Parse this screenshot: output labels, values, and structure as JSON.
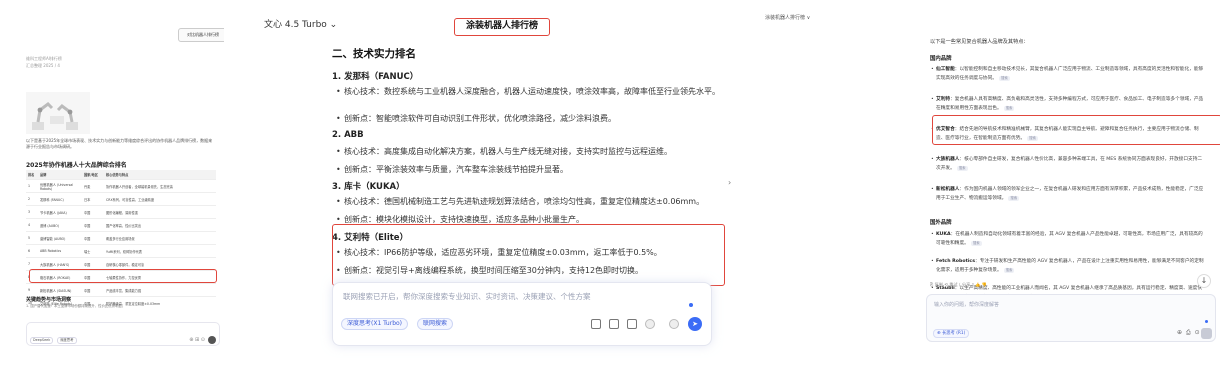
{
  "panel1": {
    "compare_button": "对比机器人排行榜",
    "meta_line1": "维科工程师AI排行榜",
    "meta_line2": "汇总整理 2025 / 4",
    "intro": "以下是基于2025年全球市场表现、技术实力与创新能力等维度综合评出的协作机器人品牌排行榜，数据来源于行业报告与市场调研。",
    "section_title": "2025年协作机器人十大品牌综合排名",
    "table_headers": [
      "排名",
      "品牌",
      "国家/地区",
      "核心优势与特点"
    ],
    "table_rows": [
      [
        "1",
        "优傲机器人 (Universal Robots)",
        "丹麦",
        "协作机器人开创者，全球装机量领先，生态完善"
      ],
      [
        "2",
        "发那科 (FANUC)",
        "日本",
        "CRX系列，可靠性高，工业级精度"
      ],
      [
        "3",
        "节卡机器人 (JAKA)",
        "中国",
        "图形化编程，易用性强"
      ],
      [
        "4",
        "邀博 (AUBO)",
        "中国",
        "国产化率高，性价比突出"
      ],
      [
        "5",
        "遨博智能 (AUBO)",
        "中国",
        "覆盖多行业应用场景"
      ],
      [
        "6",
        "ABB Robotics",
        "瑞士",
        "YuMi系列，双臂协作代表"
      ],
      [
        "7",
        "大族机器人 (HAN'S)",
        "中国",
        "自研核心零部件，稳定可靠"
      ],
      [
        "8",
        "珞石机器人 (ROKAE)",
        "中国",
        "七轴柔性协作，力控优秀"
      ],
      [
        "9",
        "新松机器人 (SIASUN)",
        "中国",
        "产品线丰富，集成能力强"
      ],
      [
        "10",
        "艾利特 (Elite Robots)",
        "中国",
        "防护等级高，重复定位精度±0.03mm"
      ]
    ],
    "subsection_title": "关键趋势与市场洞察",
    "subsection_text": "1. 国产替代加速：本土品牌市场份额持续提升，性价比优势明显。",
    "composer_chip1": "DeepSeek",
    "composer_chip2": "深度思考",
    "composer_icons": "⊕ ⊞ ⊙"
  },
  "panel2": {
    "model_selector": "文心 4.5 Turbo ⌄",
    "tab_title": "涂装机器人排行榜",
    "section_title": "二、技术实力排名",
    "brands": [
      {
        "heading": "1. 发那科（FANUC）",
        "core": "核心技术：数控系统与工业机器人深度融合，机器人运动速度快，喷涂效率高，故障率低至行业领先水平。",
        "innovation": "创新点：智能喷涂软件可自动识别工件形状，优化喷涂路径，减少涂料浪费。"
      },
      {
        "heading": "2. ABB",
        "core": "核心技术：高度集成自动化解决方案，机器人与生产线无缝对接，支持实时监控与远程运维。",
        "innovation": "创新点：平衡涂装效率与质量，汽车整车涂装线节拍提升显著。"
      },
      {
        "heading": "3. 库卡（KUKA）",
        "core": "核心技术：德国机械制造工艺与先进轨迹规划算法结合，喷涂均匀性高，重复定位精度达±0.06mm。",
        "innovation": "创新点：模块化模拟设计，支持快速换型，适应多品种小批量生产。"
      },
      {
        "heading": "4. 艾利特（Elite）",
        "core": "核心技术：IP66防护等级，适应恶劣环境，重复定位精度±0.03mm，返工率低于0.5%。",
        "innovation": "创新点：视觉引导+离线编程系统，换型时间压缩至30分钟内，支持12色即时切换。"
      }
    ],
    "composer_placeholder": "联网搜索已开启，帮你深度搜索专业知识、实时资讯、决策建议、个性方案",
    "mode1": "深度思考(X1 Turbo)",
    "mode2": "联网搜索",
    "send_icon": "➤"
  },
  "panel3": {
    "breadcrumb": "涂装机器人排行榜 ∨",
    "intro": "以下是一些常见复合机器人品牌及其特点：",
    "domestic_title": "国内品牌",
    "domestic": [
      {
        "name": "仙工智能",
        "text": "：以智能控制和自主移动技术见长，其复合机器人广泛应用于物流、工业制造等领域，具有高度的灵活性和智能化，能够实现高效的任务调度与协同。"
      },
      {
        "name": "艾利特",
        "text": "：复合机器人具有高精度、高负载和高灵活性，支持多种编程方式，可应用于医疗、食品加工、电子制造等多个领域，产品在精度和易用性方面表现出色。"
      },
      {
        "name": "优艾智合",
        "text": "：结合先进的导航技术和精准机械臂，其复合机器人能实现自主导航、避障和复合任务执行，主要应用于物流仓储、制造、医疗等行业，在智能制造方面有优势。"
      },
      {
        "name": "大族机器人",
        "text": "：核心零部件自主研发，复合机器人性价比高，兼容多种末端工具，在 MES 系统协同方面表现良好，开放接口支持二次开发。"
      },
      {
        "name": "新松机器人",
        "text": "：作为国内机器人领域的领军企业之一，在复合机器人研发和应用方面有深厚积累，产品技术成熟，性能稳定，广泛应用于工业生产、物流搬运等领域。"
      }
    ],
    "foreign_title": "国外品牌",
    "foreign": [
      {
        "name": "KUKA",
        "text": "：在机器人制造和自动化领域有着丰富的经验，其 AGV 复合机器人产品性能卓越，可靠性高，市场应用广泛，具有较高的可靠性和精度。"
      },
      {
        "name": "Fetch Robotics",
        "text": "：专注于研发和生产高性能的 AGV 复合机器人，产品在设计上注重实用性和易用性，能够满足不同客户的定制化需求，适用于多种复杂场景。"
      },
      {
        "name": "Stäubli",
        "text": "：以生产高精度、高性能的工业机器人而闻名，其 AGV 复合机器人继承了高品质基因，具有运行稳定、精度高、速度快等特点，广泛应用于汽车、电子、食品饮料等行业。"
      }
    ],
    "tag_label": "搜索",
    "actions": "⎘ 复制  ⟲ 重试  ⟨ 分享  ▯  👍  👎",
    "scroll_icon": "↓",
    "composer_placeholder": "输入你的问题，帮你深度解答",
    "mode": "⊕ 长思考 (R1)",
    "composer_icons": "⊕ ⎙ ⊙"
  },
  "colors": {
    "highlight": "#e0463c",
    "accent": "#3b6cf6"
  }
}
